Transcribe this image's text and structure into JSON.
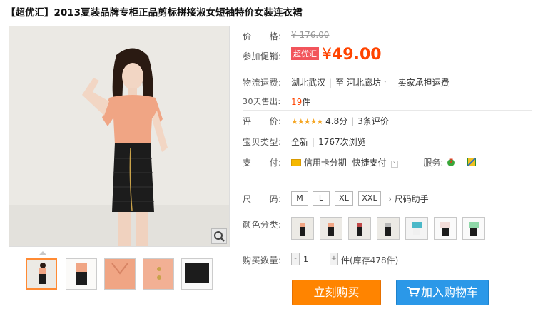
{
  "product": {
    "title": "【超优汇】2013夏装品牌专柜正品剪标拼接淑女短袖特价女装连衣裙"
  },
  "price": {
    "label": "价　　格:",
    "original": "¥ 176.00",
    "promo_label": "参加促销:",
    "promo_badge": "超优汇",
    "currency": "¥",
    "promo_price": "49.00"
  },
  "shipping": {
    "label": "物流运费:",
    "from": "湖北武汉",
    "to_prefix": "至",
    "to": "河北廊坊",
    "note": "卖家承担运费"
  },
  "sales": {
    "label": "30天售出:",
    "count": "19",
    "unit": "件"
  },
  "rating": {
    "label": "评　　价:",
    "stars": "★★★★★",
    "score": "4.8分",
    "reviews": "3条评价"
  },
  "item_type": {
    "label": "宝贝类型:",
    "condition": "全新",
    "views": "1767次浏览"
  },
  "payment": {
    "label": "支　　付:",
    "method1": "信用卡分期",
    "method2": "快捷支付",
    "service_label": "服务:",
    "service_icon_text": "7"
  },
  "size": {
    "label": "尺　　码:",
    "options": [
      "M",
      "L",
      "XL",
      "XXL"
    ],
    "helper": "尺码助手"
  },
  "color": {
    "label": "颜色分类:"
  },
  "quantity": {
    "label": "购买数量:",
    "minus": "-",
    "plus": "+",
    "value": "1",
    "unit": "件",
    "stock": "(库存478件)"
  },
  "actions": {
    "buy_now": "立刻购买",
    "add_to_cart": "加入购物车"
  },
  "colors": {
    "accent": "#ff4400",
    "buy_button": "#ff8400",
    "cart_button": "#2b98e8",
    "promo_badge": "#f2545b",
    "stars": "#f5a623"
  },
  "icons": {
    "zoom": "magnifier-icon",
    "cart": "cart-icon",
    "credit_card": "credit-card-icon",
    "dropdown": "chevron-down-icon",
    "service_7day": "seven-day-return-icon",
    "service_2": "service-badge-icon"
  }
}
